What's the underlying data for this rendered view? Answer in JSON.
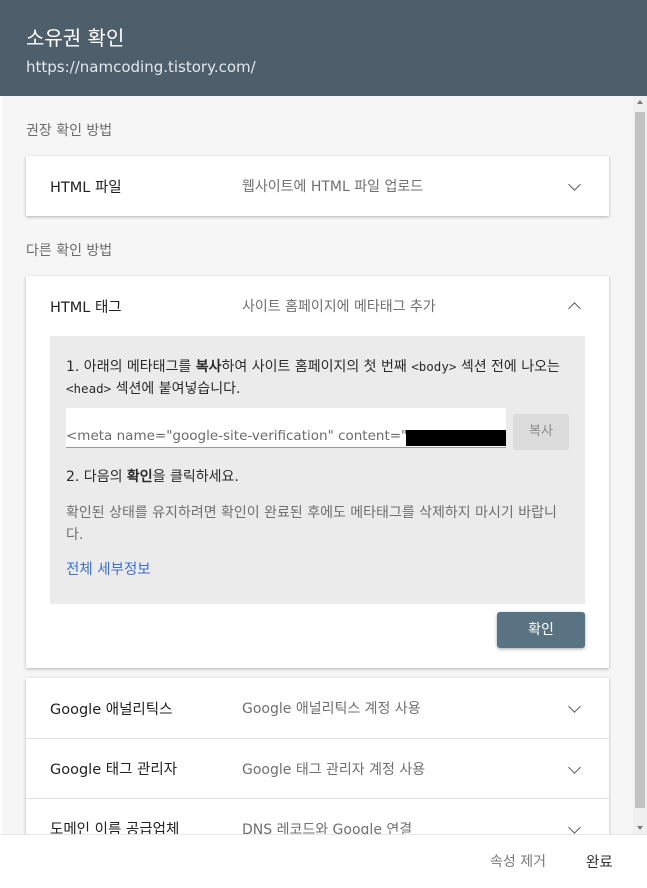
{
  "header": {
    "title": "소유권 확인",
    "url": "https://namcoding.tistory.com/"
  },
  "recommended": {
    "label": "권장 확인 방법",
    "method": {
      "name": "HTML 파일",
      "description": "웹사이트에 HTML 파일 업로드"
    }
  },
  "other": {
    "label": "다른 확인 방법",
    "html_tag": {
      "name": "HTML 태그",
      "description": "사이트 홈페이지에 메타태그 추가",
      "step1_a": "1. 아래의 메타태그를 ",
      "step1_bold": "복사",
      "step1_b": "하여 사이트 홈페이지의 첫 번째 ",
      "step1_body": "<body>",
      "step1_c": " 섹션 전에 나오는 ",
      "step1_head": "<head>",
      "step1_d": " 섹션에 붙여넣습니다.",
      "meta_value": "<meta name=\"google-site-verification\" content=\"",
      "copy_label": "복사",
      "step2_a": "2. 다음의 ",
      "step2_bold": "확인",
      "step2_b": "을 클릭하세요.",
      "note": "확인된 상태를 유지하려면 확인이 완료된 후에도 메타태그를 삭제하지 마시기 바랍니다.",
      "details_link": "전체 세부정보",
      "confirm_label": "확인"
    },
    "methods": [
      {
        "name": "Google 애널리틱스",
        "description": "Google 애널리틱스 계정 사용"
      },
      {
        "name": "Google 태그 관리자",
        "description": "Google 태그 관리자 계정 사용"
      },
      {
        "name": "도메인 이름 공급업체",
        "description": "DNS 레코드와 Google 연결"
      }
    ]
  },
  "footer": {
    "remove_label": "속성 제거",
    "done_label": "완료"
  }
}
